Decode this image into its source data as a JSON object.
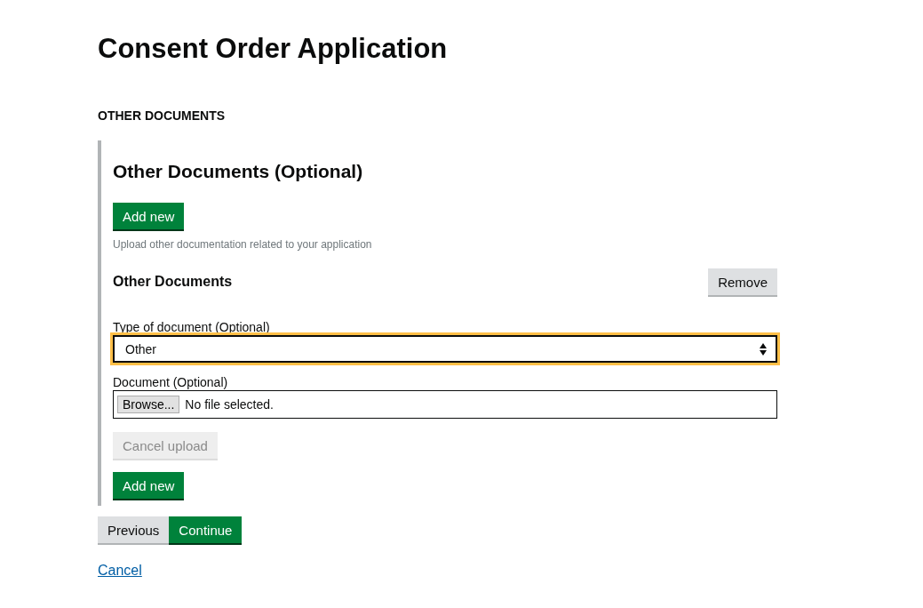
{
  "page_title": "Consent Order Application",
  "section_label": "OTHER DOCUMENTS",
  "panel": {
    "heading": "Other Documents (Optional)",
    "add_button": "Add new",
    "hint": "Upload other documentation related to your application",
    "item": {
      "heading": "Other Documents",
      "remove_button": "Remove",
      "type_field": {
        "label": "Type of document (Optional)",
        "value": "Other",
        "focused": true
      },
      "document_field": {
        "label": "Document (Optional)",
        "browse_button": "Browse...",
        "status": "No file selected."
      },
      "cancel_upload": {
        "label": "Cancel upload",
        "disabled": true
      }
    },
    "add_button_bottom": "Add new"
  },
  "nav": [
    {
      "label": "Previous",
      "kind": "secondary"
    },
    {
      "label": "Continue",
      "kind": "primary"
    }
  ],
  "cancel_link": "Cancel"
}
